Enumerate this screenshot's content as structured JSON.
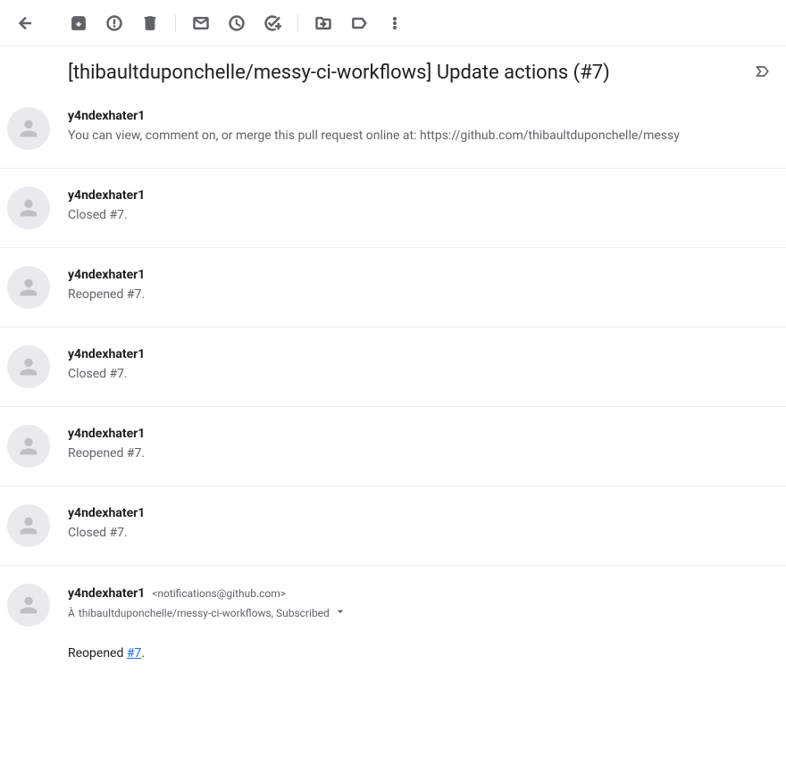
{
  "subject": "[thibaultduponchelle/messy-ci-workflows] Update actions (#7)",
  "messages": [
    {
      "sender": "y4ndexhater1",
      "snippet": "You can view, comment on, or merge this pull request online at: https://github.com/thibaultduponchelle/messy"
    },
    {
      "sender": "y4ndexhater1",
      "snippet": "Closed #7."
    },
    {
      "sender": "y4ndexhater1",
      "snippet": "Reopened #7."
    },
    {
      "sender": "y4ndexhater1",
      "snippet": "Closed #7."
    },
    {
      "sender": "y4ndexhater1",
      "snippet": "Reopened #7."
    },
    {
      "sender": "y4ndexhater1",
      "snippet": "Closed #7."
    }
  ],
  "expanded": {
    "sender": "y4ndexhater1",
    "email": "<notifications@github.com>",
    "to_prefix": "À",
    "to": "thibaultduponchelle/messy-ci-workflows, Subscribed",
    "body_prefix": "Reopened ",
    "body_link": "#7",
    "body_suffix": "."
  }
}
